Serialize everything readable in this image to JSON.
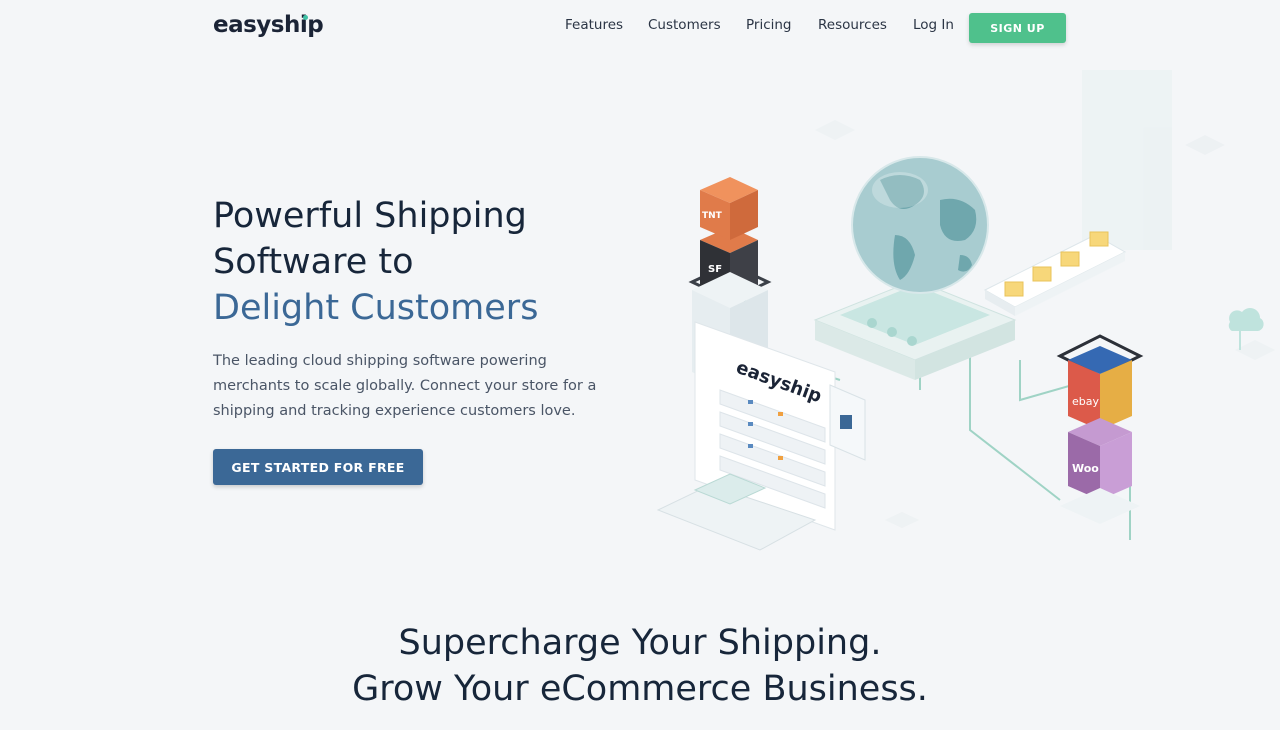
{
  "brand": {
    "name": "easyship",
    "accent": "#3fc1a5"
  },
  "nav": {
    "items": [
      {
        "label": "Features"
      },
      {
        "label": "Customers"
      },
      {
        "label": "Pricing"
      },
      {
        "label": "Resources"
      },
      {
        "label": "Log In"
      }
    ],
    "signup_label": "SIGN UP"
  },
  "hero": {
    "title_line1": "Powerful Shipping",
    "title_line2": "Software to",
    "title_accent": "Delight Customers",
    "subtitle": "The leading cloud shipping software powering merchants to scale globally. Connect your store for a shipping and tracking experience customers love.",
    "cta_label": "GET STARTED FOR FREE"
  },
  "illustration": {
    "screen_logo": "easyship",
    "box_labels": [
      "ebay",
      "Woo",
      "SF"
    ]
  },
  "section2": {
    "line1": "Supercharge Your Shipping.",
    "line2": "Grow Your eCommerce Business."
  },
  "colors": {
    "primary": "#3b6896",
    "signup": "#4fc18c",
    "background": "#f4f6f8"
  }
}
